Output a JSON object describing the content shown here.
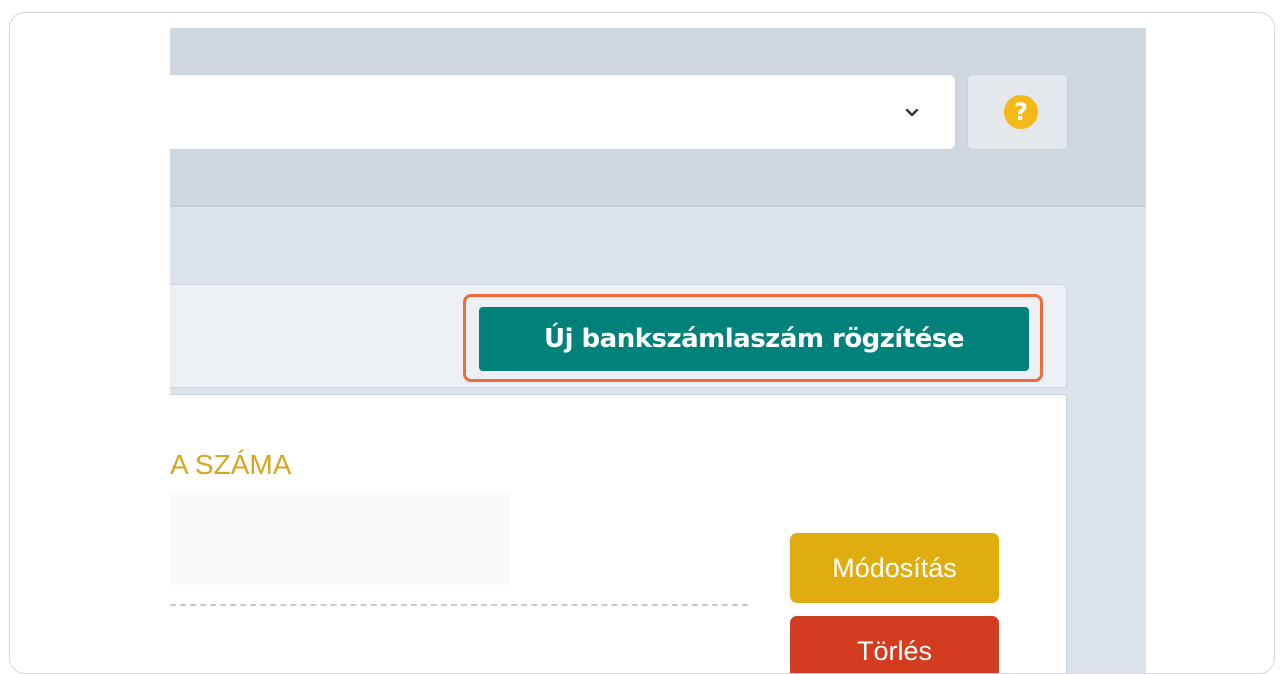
{
  "header": {
    "select_value": "",
    "help_label": "?"
  },
  "toolbar": {
    "new_account_button": "Új bankszámlaszám rögzítése"
  },
  "table": {
    "column_header": "A SZÁMA",
    "row_partial_text": "",
    "edit_button": "Módosítás",
    "delete_button": "Törlés"
  },
  "colors": {
    "accent": "#00827a",
    "highlight_outline": "#f06a3d",
    "header_text": "#d8a51e",
    "edit": "#e0ad10",
    "delete": "#d43c1f",
    "help": "#f3b917"
  },
  "icons": {
    "select_chevron": "chevron-down-icon",
    "help": "question-circle-icon"
  }
}
